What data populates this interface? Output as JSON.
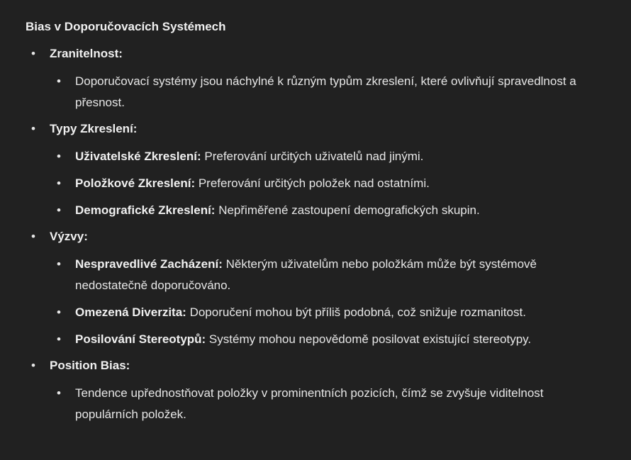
{
  "title": "Bias v Doporučovacích Systémech",
  "sections": [
    {
      "label": "Zranitelnost:",
      "items": [
        {
          "bold": "",
          "text": "Doporučovací systémy jsou náchylné k různým typům zkreslení, které ovlivňují spravedlnost a přesnost."
        }
      ]
    },
    {
      "label": "Typy Zkreslení:",
      "items": [
        {
          "bold": "Uživatelské Zkreslení:",
          "text": " Preferování určitých uživatelů nad jinými."
        },
        {
          "bold": "Položkové Zkreslení:",
          "text": " Preferování určitých položek nad ostatními."
        },
        {
          "bold": "Demografické Zkreslení:",
          "text": " Nepřiměřené zastoupení demografických skupin."
        }
      ]
    },
    {
      "label": "Výzvy:",
      "items": [
        {
          "bold": "Nespravedlivé Zacházení:",
          "text": " Některým uživatelům nebo položkám může být systémově nedostatečně doporučováno."
        },
        {
          "bold": "Omezená Diverzita:",
          "text": " Doporučení mohou být příliš podobná, což snižuje rozmanitost."
        },
        {
          "bold": "Posilování Stereotypů:",
          "text": " Systémy mohou nepovědomě posilovat existující stereotypy."
        }
      ]
    },
    {
      "label": "Position Bias:",
      "items": [
        {
          "bold": "",
          "text": "Tendence upřednostňovat položky v prominentních pozicích, čímž se zvyšuje viditelnost populárních položek."
        }
      ]
    }
  ]
}
